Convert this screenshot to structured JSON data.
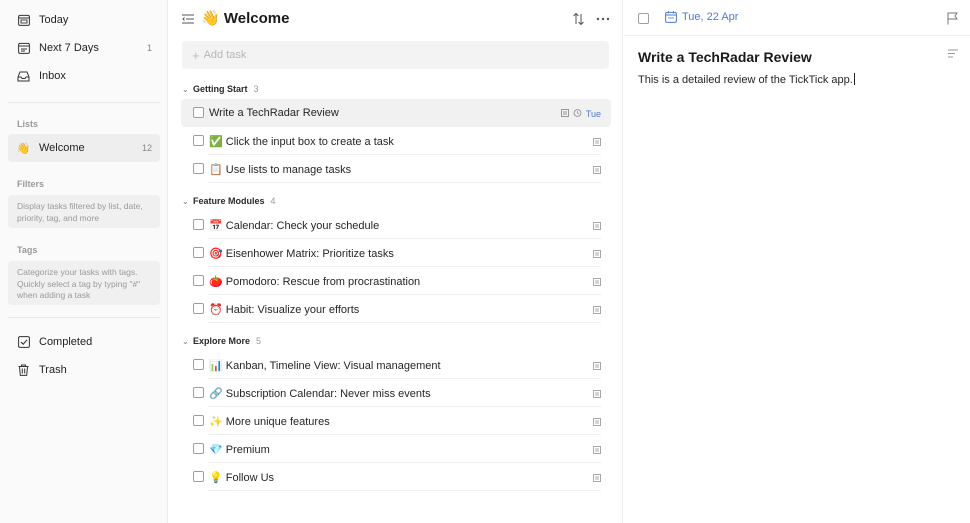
{
  "sidebar": {
    "nav": [
      {
        "label": "Today",
        "count": "",
        "icon": "calendar-today-icon"
      },
      {
        "label": "Next 7 Days",
        "count": "1",
        "icon": "calendar-week-icon"
      },
      {
        "label": "Inbox",
        "count": "",
        "icon": "inbox-icon"
      }
    ],
    "lists_label": "Lists",
    "list_item": {
      "emoji": "👋",
      "label": "Welcome",
      "count": "12"
    },
    "filters_label": "Filters",
    "filters_hint": "Display tasks filtered by list, date, priority, tag, and more",
    "tags_label": "Tags",
    "tags_hint": "Categorize your tasks with tags. Quickly select a tag by typing \"#\" when adding a task",
    "bottom": [
      {
        "label": "Completed",
        "icon": "completed-check-icon"
      },
      {
        "label": "Trash",
        "icon": "trash-icon"
      }
    ]
  },
  "main": {
    "title_emoji": "👋",
    "title": "Welcome",
    "add_task_placeholder": "Add task",
    "groups": [
      {
        "name": "Getting Start",
        "count": "3",
        "tasks": [
          {
            "title": "Write a TechRadar Review",
            "due": "Tue",
            "selected": true
          },
          {
            "title": "✅ Click the input box to create a task"
          },
          {
            "title": "📋 Use lists to manage tasks"
          }
        ]
      },
      {
        "name": "Feature Modules",
        "count": "4",
        "tasks": [
          {
            "title": "📅 Calendar: Check your schedule"
          },
          {
            "title": "🎯 Eisenhower Matrix: Prioritize tasks"
          },
          {
            "title": "🍅 Pomodoro: Rescue from procrastination"
          },
          {
            "title": "⏰ Habit: Visualize your efforts"
          }
        ]
      },
      {
        "name": "Explore More",
        "count": "5",
        "tasks": [
          {
            "title": "📊 Kanban, Timeline View: Visual management"
          },
          {
            "title": "🔗 Subscription Calendar: Never miss events"
          },
          {
            "title": "✨ More unique features"
          },
          {
            "title": "💎 Premium"
          },
          {
            "title": "💡 Follow Us"
          }
        ]
      }
    ]
  },
  "detail": {
    "date": "Tue, 22 Apr",
    "title": "Write a TechRadar Review",
    "body": "This is a detailed review of the TickTick app."
  },
  "colors": {
    "accent": "#4d7bd3",
    "sidebar_bg": "#fafafa",
    "selected_bg": "#f1f1f1"
  }
}
